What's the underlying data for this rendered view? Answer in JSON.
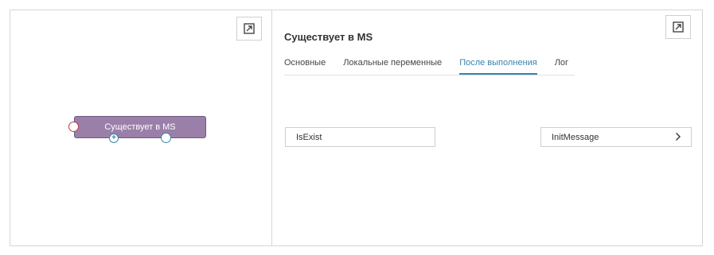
{
  "node": {
    "label": "Существует в MS"
  },
  "panel": {
    "title": "Существует в MS",
    "tabs": [
      {
        "label": "Основные"
      },
      {
        "label": "Локальные переменные"
      },
      {
        "label": "После выполнения"
      },
      {
        "label": "Лог"
      }
    ],
    "active_tab": "После выполнения",
    "mapping": {
      "left_value": "IsExist",
      "right_value": "InitMessage"
    }
  },
  "icons": {
    "expand": "expand-icon",
    "add": "plus-icon",
    "chevron": "chevron-right-icon"
  },
  "colors": {
    "accent": "#3a82b0",
    "node_fill": "#9a7fa9",
    "port_in": "#c0394b"
  }
}
